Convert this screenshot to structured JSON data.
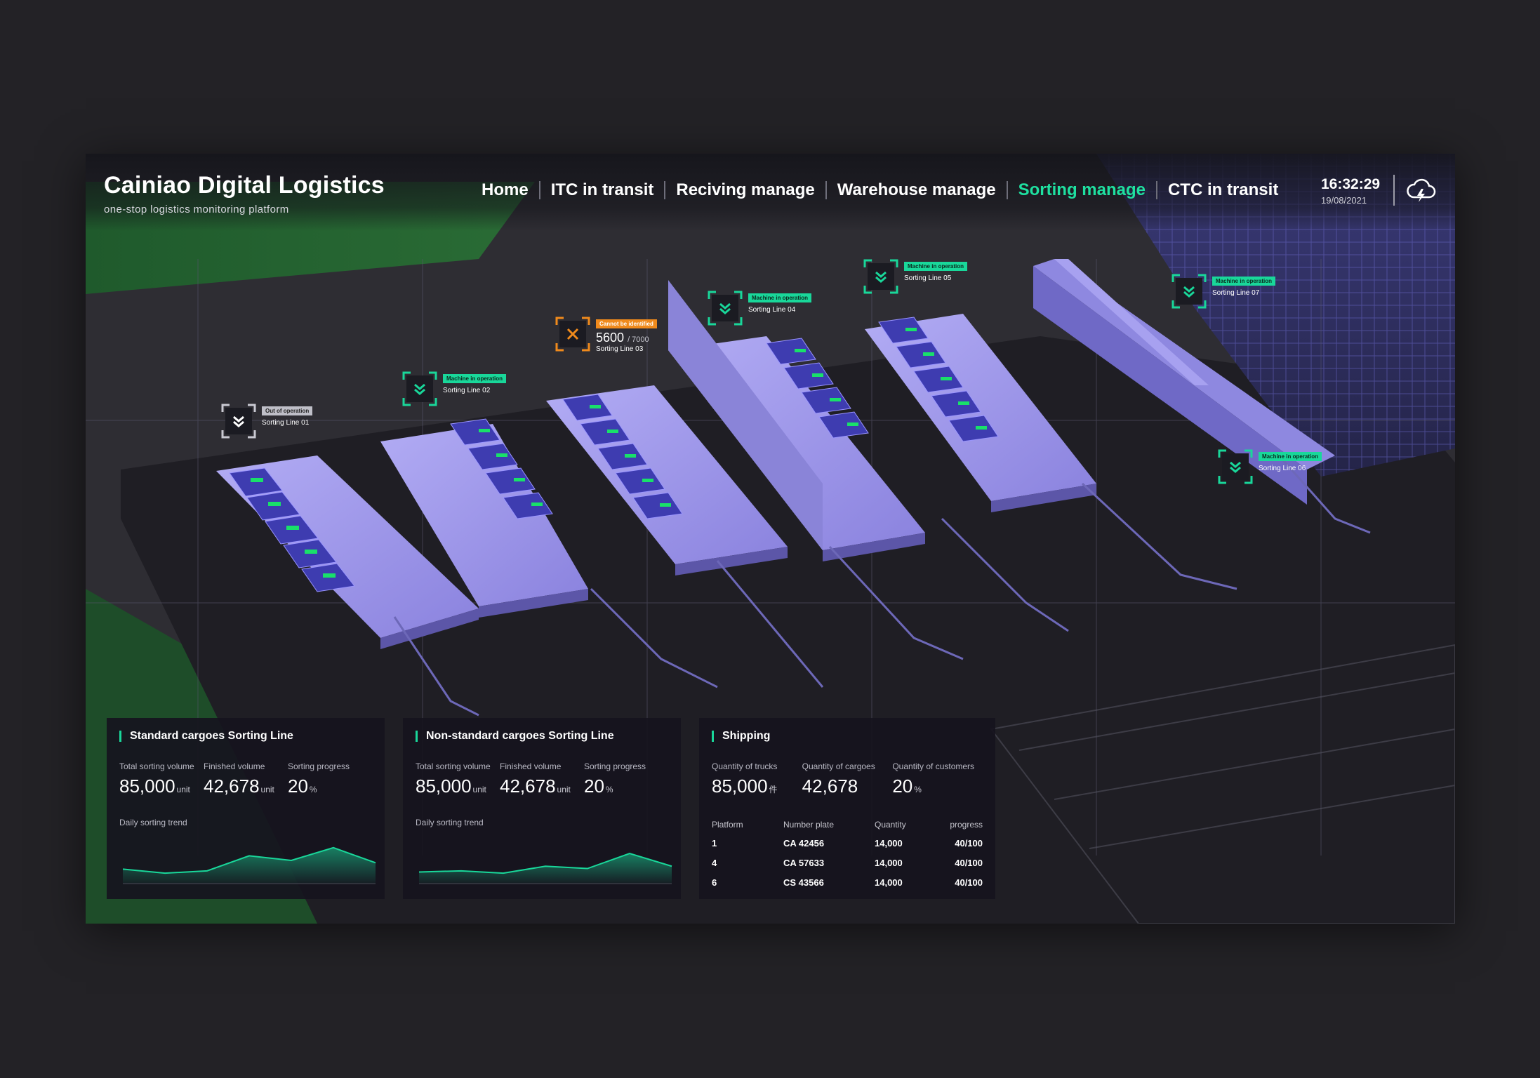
{
  "header": {
    "title": "Cainiao Digital Logistics",
    "subtitle": "one-stop logistics monitoring platform",
    "nav": [
      {
        "label": "Home",
        "active": false
      },
      {
        "label": "ITC in transit",
        "active": false
      },
      {
        "label": "Reciving manage",
        "active": false
      },
      {
        "label": "Warehouse manage",
        "active": false
      },
      {
        "label": "Sorting manage",
        "active": true
      },
      {
        "label": "CTC in transit",
        "active": false
      }
    ],
    "time": "16:32:29",
    "date": "19/08/2021",
    "weather_icon": "thunderstorm-cloud-icon"
  },
  "colors": {
    "accent": "#1fe0a0",
    "warning": "#f08a1c",
    "machine": "#8f86e6"
  },
  "lines": [
    {
      "name": "Sorting Line 01",
      "status": "Out of operation",
      "state": "off"
    },
    {
      "name": "Sorting Line 02",
      "status": "Machine in operation",
      "state": "on"
    },
    {
      "name": "Sorting Line 03",
      "status": "Cannot be identified",
      "state": "error",
      "count": "5600",
      "total": "/ 7000"
    },
    {
      "name": "Sorting Line 04",
      "status": "Machine in operation",
      "state": "on"
    },
    {
      "name": "Sorting Line 05",
      "status": "Machine in operation",
      "state": "on"
    },
    {
      "name": "Sorting Line 06",
      "status": "Machine in operation",
      "state": "on"
    },
    {
      "name": "Sorting Line 07",
      "status": "Machine in operation",
      "state": "on"
    }
  ],
  "panels": {
    "standard": {
      "title": "Standard cargoes Sorting Line",
      "stats": [
        {
          "label": "Total sorting volume",
          "value": "85,000",
          "unit": "unit"
        },
        {
          "label": "Finished volume",
          "value": "42,678",
          "unit": "unit"
        },
        {
          "label": "Sorting progress",
          "value": "20",
          "unit": "%"
        }
      ],
      "trend_label": "Daily sorting trend",
      "trend": [
        25,
        18,
        22,
        48,
        40,
        62,
        36
      ]
    },
    "nonstandard": {
      "title": "Non-standard cargoes Sorting Line",
      "stats": [
        {
          "label": "Total sorting volume",
          "value": "85,000",
          "unit": "unit"
        },
        {
          "label": "Finished volume",
          "value": "42,678",
          "unit": "unit"
        },
        {
          "label": "Sorting progress",
          "value": "20",
          "unit": "%"
        }
      ],
      "trend_label": "Daily sorting trend",
      "trend": [
        20,
        22,
        18,
        30,
        26,
        52,
        30
      ]
    },
    "shipping": {
      "title": "Shipping",
      "stats": [
        {
          "label": "Quantity of trucks",
          "value": "85,000",
          "unit": "件"
        },
        {
          "label": "Quantity of cargoes",
          "value": "42,678",
          "unit": ""
        },
        {
          "label": "Quantity of customers",
          "value": "20",
          "unit": "%"
        }
      ],
      "columns": [
        "Platform",
        "Number plate",
        "Quantity",
        "progress"
      ],
      "rows": [
        [
          "1",
          "CA 42456",
          "14,000",
          "40/100"
        ],
        [
          "4",
          "CA 57633",
          "14,000",
          "40/100"
        ],
        [
          "6",
          "CS 43566",
          "14,000",
          "40/100"
        ]
      ]
    }
  }
}
